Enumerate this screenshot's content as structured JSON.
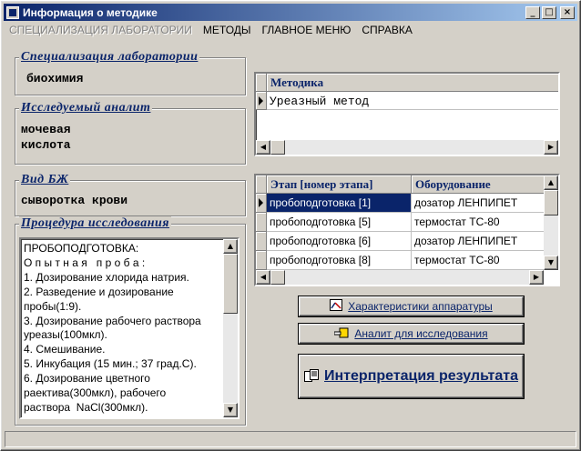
{
  "window": {
    "title": "Информация о методике"
  },
  "titlebar_buttons": {
    "minimize": "_",
    "maximize": "□",
    "close": "×"
  },
  "menu": [
    {
      "label": "СПЕЦИАЛИЗАЦИЯ ЛАБОРАТОРИИ",
      "disabled": true
    },
    {
      "label": "МЕТОДЫ",
      "disabled": false
    },
    {
      "label": "ГЛАВНОЕ МЕНЮ",
      "disabled": false
    },
    {
      "label": "СПРАВКА",
      "disabled": false
    }
  ],
  "groups": {
    "specialization": {
      "title": "Специализация лаборатории",
      "value": "биохимия"
    },
    "analyte": {
      "title": "Исследуемый аналит",
      "value": "мочевая\nкислота"
    },
    "sample": {
      "title": "Вид БЖ",
      "value": "сыворотка крови"
    },
    "procedure": {
      "title": "Процедура исследования"
    }
  },
  "procedure_text": [
    "ПРОБОПОДГОТОВКА:",
    "О п ы т н а я   п р о б а :",
    "1. Дозирование хлорида натрия.",
    "2. Разведение и дозирование",
    "пробы(1:9).",
    "3. Дозирование рабочего раствора",
    "уреазы(100мкл).",
    "4. Смешивание.",
    "5. Инкубация (15 мин.; 37 град.С).",
    "6. Дозирование цветного",
    "раектива(300мкл), рабочего",
    "раствора  NaCl(300мкл)."
  ],
  "method_grid": {
    "header": "Методика",
    "rows": [
      "Уреазный метод"
    ]
  },
  "stage_grid": {
    "headers": [
      "Этап [номер этапа]",
      "Оборудование"
    ],
    "rows": [
      {
        "stage": "пробоподготовка [1]",
        "equipment": "дозатор ЛЕНПИПЕТ"
      },
      {
        "stage": "пробоподготовка [5]",
        "equipment": "термостат ТС-80"
      },
      {
        "stage": "пробоподготовка [6]",
        "equipment": "дозатор ЛЕНПИПЕТ"
      },
      {
        "stage": "пробоподготовка [8]",
        "equipment": "термостат ТС-80"
      }
    ]
  },
  "buttons": {
    "equipment": "Характеристики аппаратуры",
    "analyte": "Аналит для исследования",
    "interpret": "Интерпретация результата"
  },
  "scroll_glyphs": {
    "up": "▲",
    "down": "▼",
    "left": "◀",
    "right": "▶"
  },
  "icons": {
    "app": "app-icon",
    "equipment_button": "chart-icon",
    "analyte_button": "hand-pointer-icon",
    "interpret_button": "document-icon"
  }
}
